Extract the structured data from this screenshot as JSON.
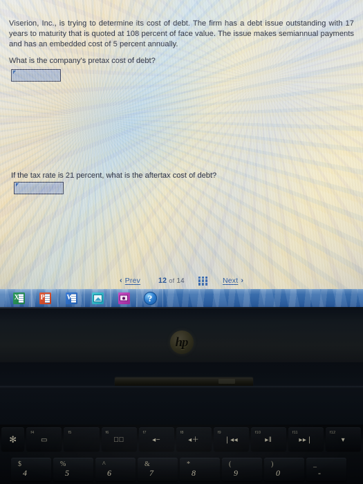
{
  "screen": {
    "problem_text": "Viserion, Inc., is trying to determine its cost of debt. The firm has a debt issue outstanding with 17 years to maturity that is quoted at 108 percent of face value. The issue makes semiannual payments and has an embedded cost of 5 percent annually.",
    "question_1": "What is the company's pretax cost of debt?",
    "question_2": "If the tax rate is 21 percent, what is the aftertax cost of debt?",
    "answer_1": "",
    "answer_2": "",
    "nav": {
      "prev_label": "Prev",
      "next_label": "Next",
      "prev_chevron": "‹",
      "next_chevron": "›",
      "current_page": "12",
      "of_label": "of",
      "total_pages": "14",
      "grid_icon": "grid-icon"
    }
  },
  "taskbar": {
    "items": [
      {
        "name": "excel",
        "glyph": "X"
      },
      {
        "name": "powerpoint",
        "glyph": "P"
      },
      {
        "name": "word",
        "glyph": "W"
      },
      {
        "name": "photo-viewer",
        "glyph": ""
      },
      {
        "name": "camera",
        "glyph": ""
      },
      {
        "name": "help",
        "glyph": "?"
      }
    ]
  },
  "laptop": {
    "brand": "hp"
  },
  "keyboard": {
    "function_row": [
      {
        "fn": "",
        "sym": "✻",
        "name": "brightness-key"
      },
      {
        "fn": "f4",
        "sym": "▭",
        "name": "display-key"
      },
      {
        "fn": "f5",
        "sym": "",
        "name": "f5-key"
      },
      {
        "fn": "f6",
        "sym": "◂⃠",
        "name": "mute-key"
      },
      {
        "fn": "f7",
        "sym": "◂−",
        "name": "volume-down-key"
      },
      {
        "fn": "f8",
        "sym": "◂＋",
        "name": "volume-up-key"
      },
      {
        "fn": "f9",
        "sym": "❘◂◂",
        "name": "previous-track-key"
      },
      {
        "fn": "f10",
        "sym": "▸‖",
        "name": "play-pause-key"
      },
      {
        "fn": "f11",
        "sym": "▸▸❘",
        "name": "next-track-key"
      },
      {
        "fn": "f12",
        "sym": "▾",
        "name": "f12-key"
      }
    ],
    "number_row": [
      {
        "shifted": "$",
        "base": "4"
      },
      {
        "shifted": "%",
        "base": "5"
      },
      {
        "shifted": "^",
        "base": "6"
      },
      {
        "shifted": "&",
        "base": "7"
      },
      {
        "shifted": "*",
        "base": "8"
      },
      {
        "shifted": "(",
        "base": "9"
      },
      {
        "shifted": ")",
        "base": "0"
      },
      {
        "shifted": "_",
        "base": "-"
      }
    ]
  },
  "colors": {
    "link": "#2f5fa8",
    "accent": "#25559c",
    "taskbar": "#3f76b8",
    "input_fill": "#b4c0d3",
    "input_border": "#3d4560"
  }
}
